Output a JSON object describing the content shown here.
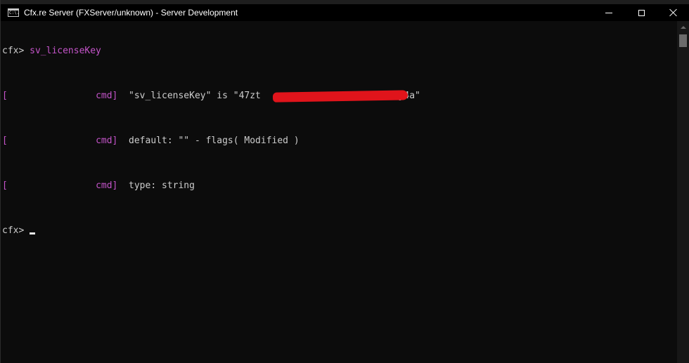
{
  "window": {
    "title": "Cfx.re Server (FXServer/unknown) - Server Development",
    "icon_text": "C:\\."
  },
  "console": {
    "prompt": "cfx>",
    "command": "sv_licenseKey",
    "bracket": "[",
    "tag": "cmd]",
    "lines": [
      "\"sv_licenseKey\" is \"47zt",
      "default: \"\" - flags( Modified )",
      "type: string"
    ],
    "line1_suffix": "7j4a\""
  },
  "icons": {
    "app": "console-app-icon",
    "minimize": "minimize-icon",
    "maximize": "maximize-icon",
    "close": "close-icon"
  },
  "colors": {
    "accent_magenta": "#c454c9",
    "redaction": "#e0141b",
    "background": "#0c0c0c",
    "text": "#cccccc"
  }
}
